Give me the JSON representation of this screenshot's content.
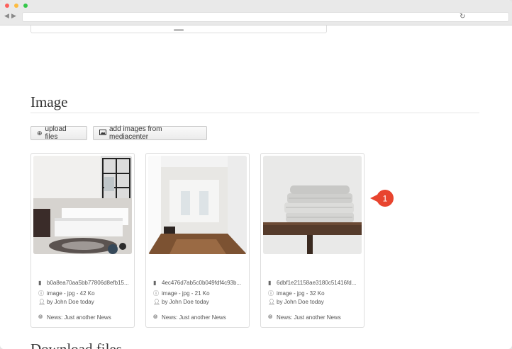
{
  "browser": {
    "back_glyph": "◀",
    "forward_glyph": "▶",
    "reload_glyph": "↻",
    "url": ""
  },
  "section": {
    "title": "Image",
    "next_title": "Download files"
  },
  "buttons": {
    "upload_label": "upload files",
    "media_label": "add images from mediacenter"
  },
  "cards": [
    {
      "filename": "b0a8ea70aa5bb77806d8efb15...",
      "type_size": "image - jpg - 42 Ko",
      "author": "by John Doe today",
      "link": "News: Just another News"
    },
    {
      "filename": "4ec476d7ab5c0b049fdf4c93b...",
      "type_size": "image - jpg - 21 Ko",
      "author": "by John Doe today",
      "link": "News: Just another News"
    },
    {
      "filename": "6dbf1e21158ae3180c51416fd...",
      "type_size": "image - jpg - 32 Ko",
      "author": "by John Doe today",
      "link": "News: Just another News"
    }
  ],
  "callout": {
    "number": "1",
    "color": "#e8442e"
  },
  "icons": {
    "upload": "upload-icon",
    "image": "image-icon",
    "file": "file-icon",
    "info": "info-icon",
    "user": "user-icon",
    "globe": "globe-icon"
  }
}
